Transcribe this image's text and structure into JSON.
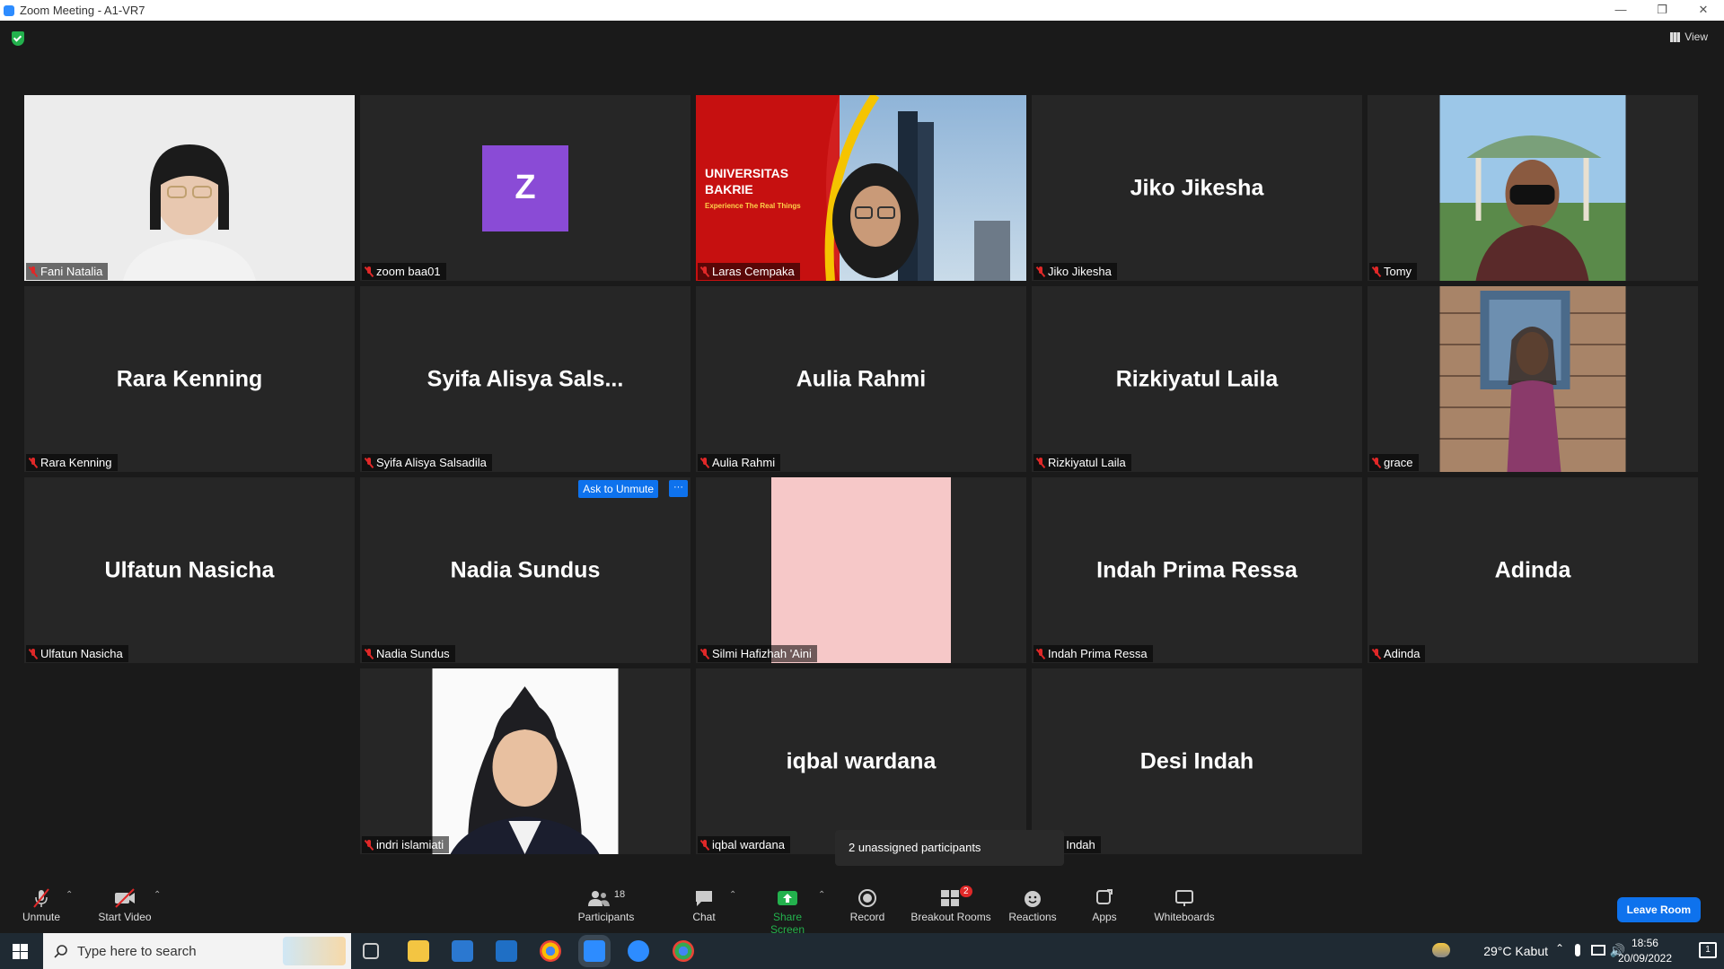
{
  "window": {
    "title": "Zoom Meeting - A1-VR7",
    "minimize": "—",
    "restore": "❐",
    "close": "✕"
  },
  "header": {
    "view_label": "View"
  },
  "tiles": [
    {
      "name": "Fani Natalia",
      "kind": "video",
      "bg": "#eaeaea"
    },
    {
      "name": "zoom baa01",
      "kind": "avatar",
      "initial": "Z",
      "avatar_color": "#8a4bd6"
    },
    {
      "name": "Laras Cempaka",
      "kind": "video",
      "active": true,
      "bg_text": [
        "UNIVERSITAS",
        "BAKRIE",
        "Experience The Real Things"
      ]
    },
    {
      "name": "Jiko Jikesha",
      "kind": "name"
    },
    {
      "name": "Tomy",
      "kind": "video"
    },
    {
      "name": "Rara Kenning",
      "kind": "name"
    },
    {
      "name": "Syifa Alisya Salsadila",
      "display": "Syifa Alisya Sals...",
      "kind": "name"
    },
    {
      "name": "Aulia Rahmi",
      "kind": "name"
    },
    {
      "name": "Rizkiyatul Laila",
      "kind": "name"
    },
    {
      "name": "grace",
      "kind": "video"
    },
    {
      "name": "Ulfatun Nasicha",
      "kind": "name"
    },
    {
      "name": "Nadia Sundus",
      "kind": "name",
      "ask_label": "Ask to Unmute",
      "more_label": "···"
    },
    {
      "name": "Silmi Hafizhah 'Aini",
      "kind": "pink"
    },
    {
      "name": "Indah Prima Ressa",
      "kind": "name"
    },
    {
      "name": "Adinda",
      "kind": "name"
    },
    {
      "name": "indri islamiati",
      "kind": "video"
    },
    {
      "name": "iqbal wardana",
      "kind": "name"
    },
    {
      "name": "Desi Indah",
      "label_display": "esi Indah",
      "kind": "name"
    }
  ],
  "tooltip": "2 unassigned participants",
  "toolbar": {
    "unmute": "Unmute",
    "start_video": "Start Video",
    "participants": "Participants",
    "participants_count": "18",
    "chat": "Chat",
    "share_screen": "Share Screen",
    "record": "Record",
    "breakout_rooms": "Breakout Rooms",
    "breakout_badge": "2",
    "reactions": "Reactions",
    "apps": "Apps",
    "whiteboards": "Whiteboards",
    "leave": "Leave Room"
  },
  "taskbar": {
    "search_placeholder": "Type here to search",
    "weather": "29°C  Kabut",
    "time": "18:56",
    "date": "20/09/2022",
    "notif_count": "1"
  }
}
